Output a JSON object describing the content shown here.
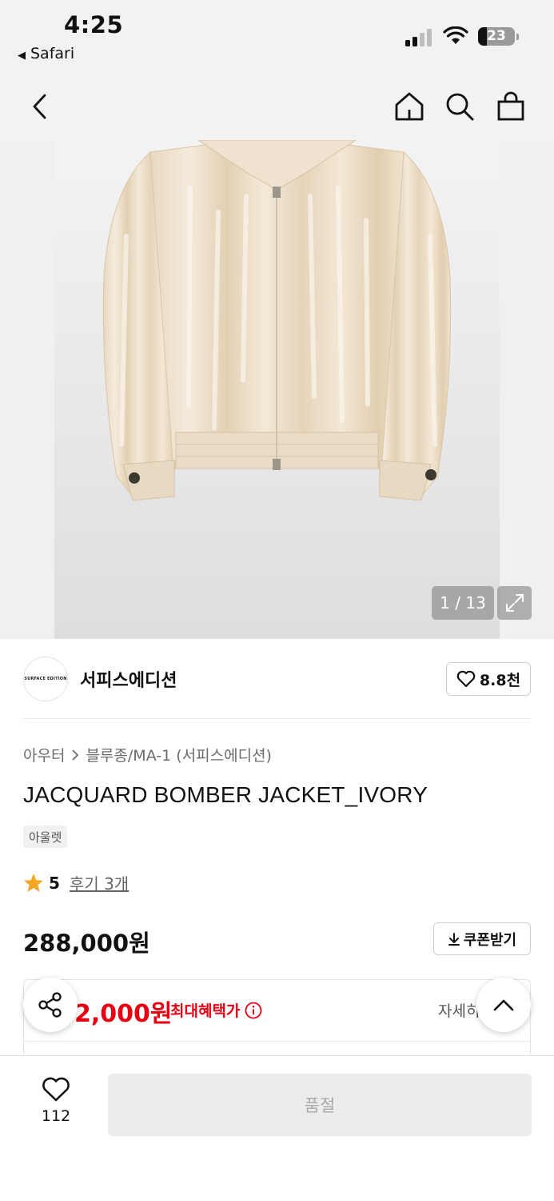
{
  "status_bar": {
    "time": "4:25",
    "back_app": "Safari",
    "battery": "23"
  },
  "header": {
    "icons": [
      "back-chevron-icon",
      "home-icon",
      "search-icon",
      "shopping-bag-icon"
    ]
  },
  "gallery": {
    "counter": "1 / 13",
    "image_alt": "ivory jacquard bomber jacket product photo",
    "expand_icon": "expand-icon"
  },
  "brand": {
    "logo_text": "SURFACE EDITION",
    "name": "서피스에디션",
    "likes": "8.8천"
  },
  "product": {
    "breadcrumb": {
      "category": "아우터",
      "subcategory": "블루종/MA-1 (서피스에디션)"
    },
    "title": "JACQUARD BOMBER JACKET_IVORY",
    "tag": "아울렛",
    "rating": {
      "score": "5",
      "reviews": "후기 3개"
    },
    "price": "288,000원",
    "coupon_label": "쿠폰받기"
  },
  "benefit": {
    "max_price": "2,000원",
    "label": "최대혜택가",
    "detail": "자세히"
  },
  "bottom_bar": {
    "wish_count": "112",
    "action_label": "품절"
  },
  "colors": {
    "accent_red": "#e60012",
    "soldout_bg": "#ececec",
    "soldout_text": "#a9a9a9",
    "star": "#f5a623"
  }
}
